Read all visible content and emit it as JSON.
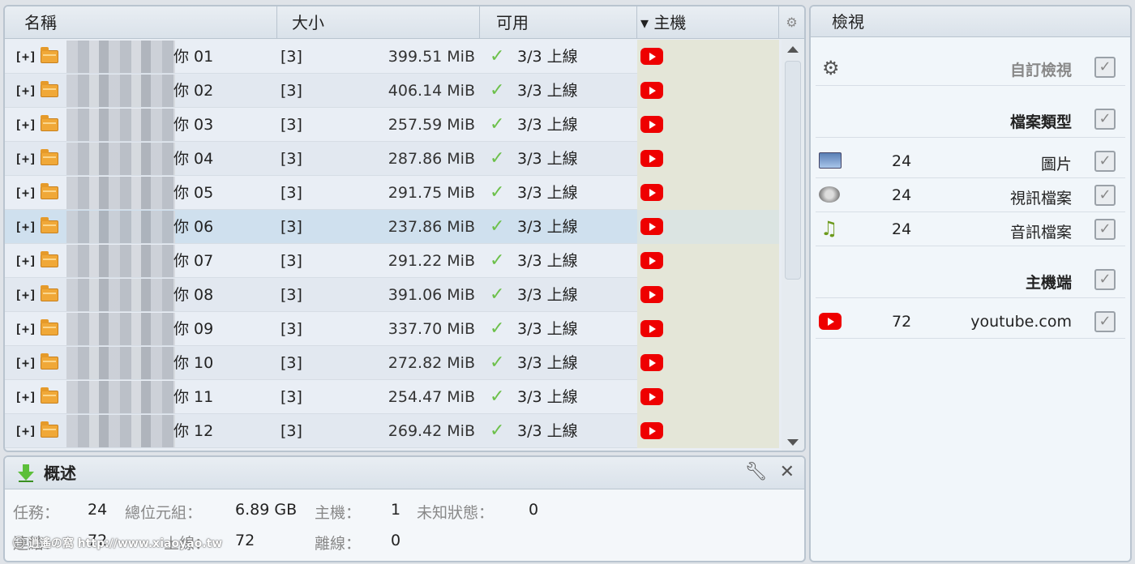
{
  "list": {
    "columns": {
      "name": "名稱",
      "size": "大小",
      "avail": "可用",
      "host": "▾ 主機"
    },
    "rows": [
      {
        "expander": "[+]",
        "name": "你 01",
        "count": "[3]",
        "size": "399.51 MiB",
        "avail": "3/3 上線"
      },
      {
        "expander": "[+]",
        "name": "你 02",
        "count": "[3]",
        "size": "406.14 MiB",
        "avail": "3/3 上線"
      },
      {
        "expander": "[+]",
        "name": "你 03",
        "count": "[3]",
        "size": "257.59 MiB",
        "avail": "3/3 上線"
      },
      {
        "expander": "[+]",
        "name": "你 04",
        "count": "[3]",
        "size": "287.86 MiB",
        "avail": "3/3 上線"
      },
      {
        "expander": "[+]",
        "name": "你 05",
        "count": "[3]",
        "size": "291.75 MiB",
        "avail": "3/3 上線"
      },
      {
        "expander": "[+]",
        "name": "你 06",
        "count": "[3]",
        "size": "237.86 MiB",
        "avail": "3/3 上線"
      },
      {
        "expander": "[+]",
        "name": "你 07",
        "count": "[3]",
        "size": "291.22 MiB",
        "avail": "3/3 上線"
      },
      {
        "expander": "[+]",
        "name": "你 08",
        "count": "[3]",
        "size": "391.06 MiB",
        "avail": "3/3 上線"
      },
      {
        "expander": "[+]",
        "name": "你 09",
        "count": "[3]",
        "size": "337.70 MiB",
        "avail": "3/3 上線"
      },
      {
        "expander": "[+]",
        "name": "你 10",
        "count": "[3]",
        "size": "272.82 MiB",
        "avail": "3/3 上線"
      },
      {
        "expander": "[+]",
        "name": "你 11",
        "count": "[3]",
        "size": "254.47 MiB",
        "avail": "3/3 上線"
      },
      {
        "expander": "[+]",
        "name": "你 12",
        "count": "[3]",
        "size": "269.42 MiB",
        "avail": "3/3 上線"
      }
    ],
    "selected_row": 5,
    "host_icon": "youtube-icon"
  },
  "view": {
    "title": "檢視",
    "custom_view": "自訂檢視",
    "file_types": "檔案類型",
    "types": [
      {
        "icon": "image-icon",
        "count": "24",
        "label": "圖片"
      },
      {
        "icon": "video-icon",
        "count": "24",
        "label": "視訊檔案"
      },
      {
        "icon": "music-icon",
        "count": "24",
        "label": "音訊檔案"
      }
    ],
    "hosts_label": "主機端",
    "hosts": [
      {
        "icon": "youtube-icon",
        "count": "72",
        "label": "youtube.com"
      }
    ],
    "checkmark": "✓"
  },
  "overview": {
    "title": "概述",
    "tasks_label": "任務：",
    "tasks": "24",
    "bytes_label": "總位元組：",
    "bytes": "6.89 GB",
    "hosts_label": "主機：",
    "hosts": "1",
    "unknown_label": "未知狀態：",
    "unknown": "0",
    "links_label": "連結：",
    "links": "72",
    "online_label": "上線：",
    "online": "72",
    "offline_label": "離線：",
    "offline": "0",
    "watermark": "㊀ 逍遙の窩 http://www.xiaoyao.tw"
  },
  "colors": {
    "accent": "#6cc04a",
    "youtube": "#ee0000",
    "header": "#dae2ea"
  }
}
